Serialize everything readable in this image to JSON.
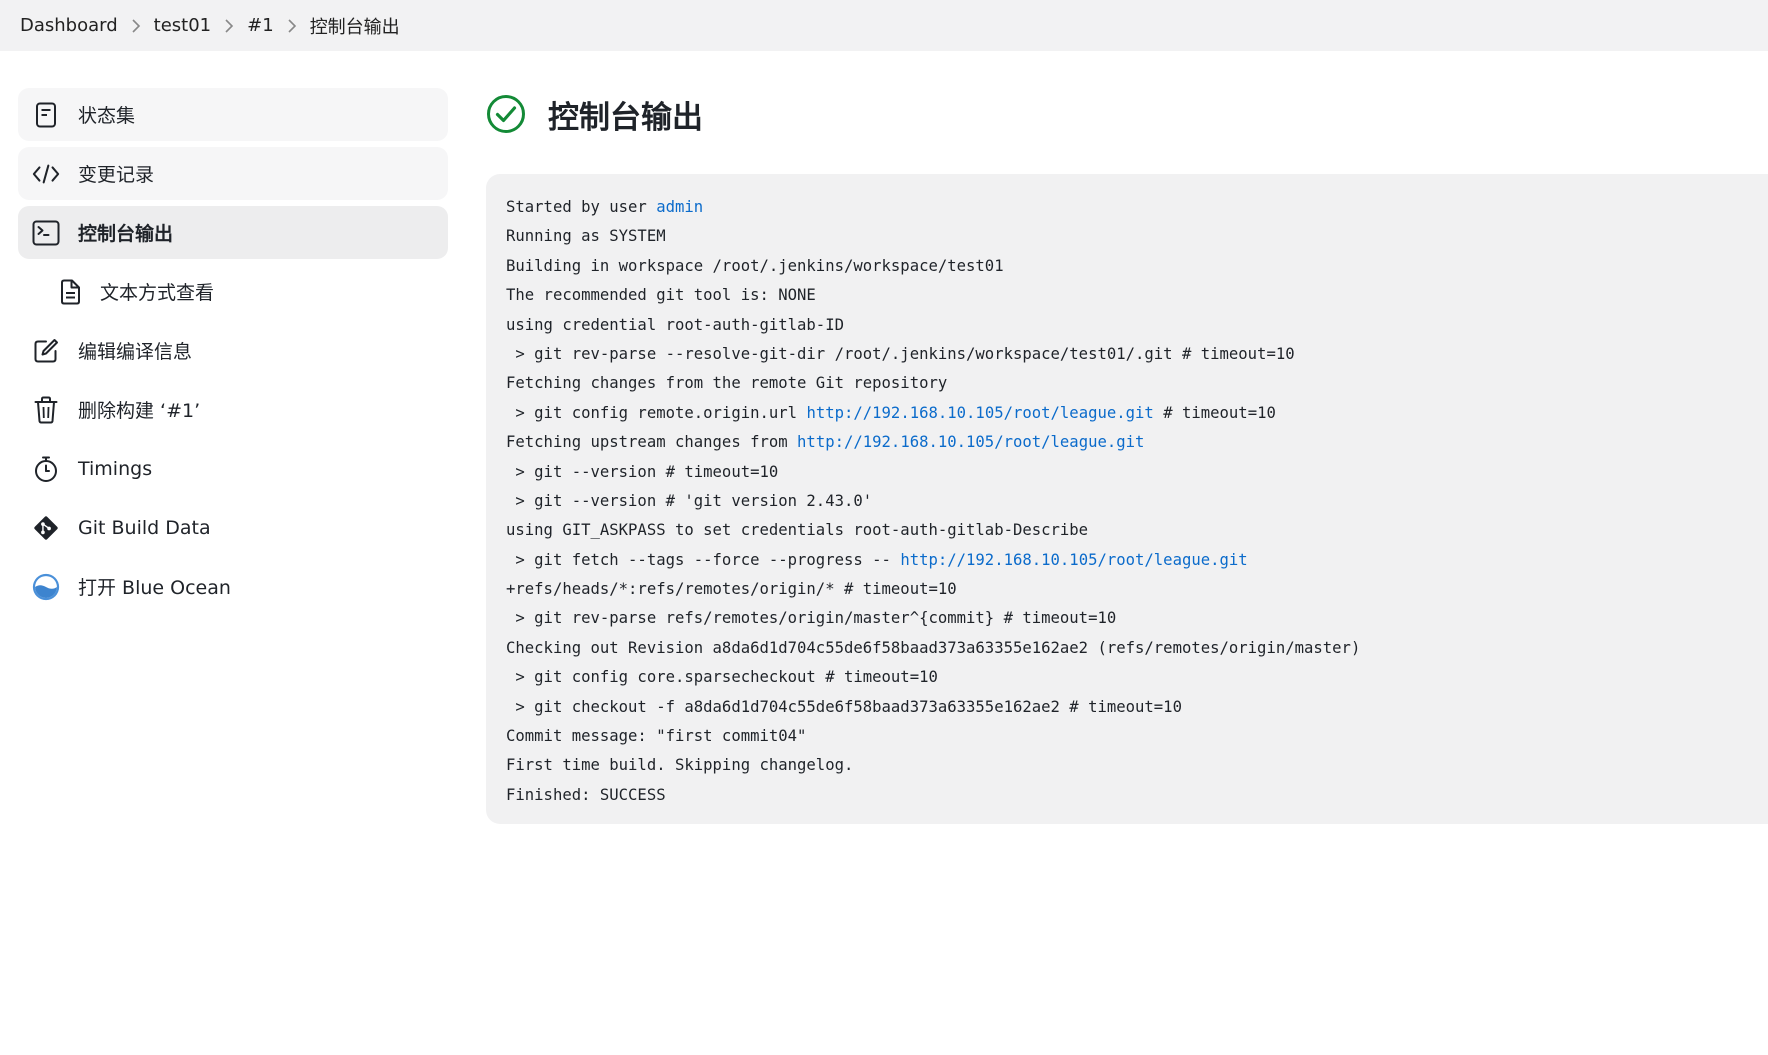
{
  "breadcrumb": {
    "items": [
      "Dashboard",
      "test01",
      "#1",
      "控制台输出"
    ]
  },
  "sidebar": {
    "items": [
      {
        "label": "状态集",
        "icon": "document-icon"
      },
      {
        "label": "变更记录",
        "icon": "code-icon"
      },
      {
        "label": "控制台输出",
        "icon": "terminal-icon"
      },
      {
        "label": "文本方式查看",
        "icon": "file-text-icon"
      },
      {
        "label": "编辑编译信息",
        "icon": "edit-icon"
      },
      {
        "label": "删除构建 ‘#1’",
        "icon": "trash-icon"
      },
      {
        "label": "Timings",
        "icon": "stopwatch-icon"
      },
      {
        "label": "Git Build Data",
        "icon": "git-icon"
      },
      {
        "label": "打开 Blue Ocean",
        "icon": "blue-ocean-icon"
      }
    ]
  },
  "main": {
    "title": "控制台输出",
    "status": "success",
    "status_color": "#138a36"
  },
  "console": {
    "link_color": "#0b6bcb",
    "lines": [
      {
        "text": "Started by user ",
        "link": "admin",
        "after": ""
      },
      {
        "text": "Running as SYSTEM"
      },
      {
        "text": "Building in workspace /root/.jenkins/workspace/test01"
      },
      {
        "text": "The recommended git tool is: NONE"
      },
      {
        "text": "using credential root-auth-gitlab-ID"
      },
      {
        "text": " > git rev-parse --resolve-git-dir /root/.jenkins/workspace/test01/.git # timeout=10"
      },
      {
        "text": "Fetching changes from the remote Git repository"
      },
      {
        "text": " > git config remote.origin.url ",
        "link": "http://192.168.10.105/root/league.git",
        "after": " # timeout=10"
      },
      {
        "text": "Fetching upstream changes from ",
        "link": "http://192.168.10.105/root/league.git",
        "after": ""
      },
      {
        "text": " > git --version # timeout=10"
      },
      {
        "text": " > git --version # 'git version 2.43.0'"
      },
      {
        "text": "using GIT_ASKPASS to set credentials root-auth-gitlab-Describe"
      },
      {
        "text": " > git fetch --tags --force --progress -- ",
        "link": "http://192.168.10.105/root/league.git",
        "after": ""
      },
      {
        "text": "+refs/heads/*:refs/remotes/origin/* # timeout=10"
      },
      {
        "text": " > git rev-parse refs/remotes/origin/master^{commit} # timeout=10"
      },
      {
        "text": "Checking out Revision a8da6d1d704c55de6f58baad373a63355e162ae2 (refs/remotes/origin/master)"
      },
      {
        "text": " > git config core.sparsecheckout # timeout=10"
      },
      {
        "text": " > git checkout -f a8da6d1d704c55de6f58baad373a63355e162ae2 # timeout=10"
      },
      {
        "text": "Commit message: \"first commit04\""
      },
      {
        "text": "First time build. Skipping changelog."
      },
      {
        "text": "Finished: SUCCESS"
      }
    ]
  }
}
